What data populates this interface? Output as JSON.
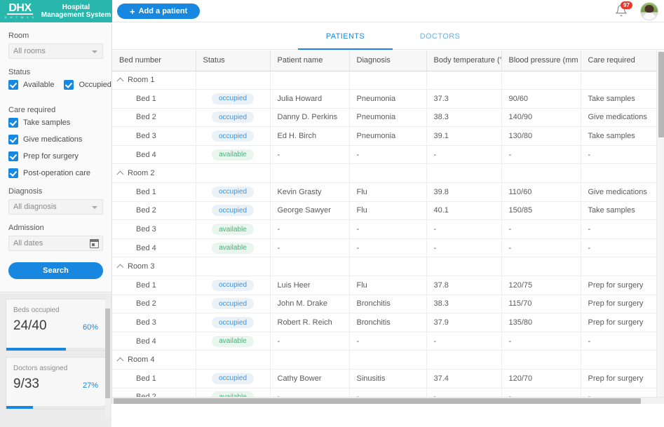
{
  "header": {
    "logo_mark": "DHX",
    "logo_sub": "D H T M L X",
    "app_title": "Hospital Management System",
    "add_patient_label": "Add a patient",
    "plus_icon": "+",
    "notification_count": "97"
  },
  "sidebar": {
    "room_label": "Room",
    "room_value": "All rooms",
    "status_label": "Status",
    "status_options": [
      {
        "label": "Available",
        "checked": true
      },
      {
        "label": "Occupied",
        "checked": true
      }
    ],
    "care_label": "Care required",
    "care_options": [
      {
        "label": "Take samples",
        "checked": true
      },
      {
        "label": "Give medications",
        "checked": true
      },
      {
        "label": "Prep for surgery",
        "checked": true
      },
      {
        "label": "Post-operation care",
        "checked": true
      }
    ],
    "diagnosis_label": "Diagnosis",
    "diagnosis_value": "All diagnosis",
    "admission_label": "Admission",
    "admission_value": "All dates",
    "search_label": "Search"
  },
  "stats": [
    {
      "title": "Beds occupied",
      "value": "24/40",
      "percent": "60%",
      "fill": 60
    },
    {
      "title": "Doctors assigned",
      "value": "9/33",
      "percent": "27%",
      "fill": 27
    }
  ],
  "tabs": [
    {
      "label": "PATIENTS",
      "active": true
    },
    {
      "label": "DOCTORS",
      "active": false
    }
  ],
  "table": {
    "columns": [
      "Bed number",
      "Status",
      "Patient name",
      "Diagnosis",
      "Body temperature (°C)",
      "Blood pressure (mm HG)",
      "Care required"
    ],
    "rows": [
      {
        "type": "group",
        "label": "Room 1"
      },
      {
        "type": "bed",
        "bed": "Bed 1",
        "status": "occupied",
        "name": "Julia Howard",
        "diagnosis": "Pneumonia",
        "temp": "37.3",
        "pressure": "90/60",
        "care": "Take samples"
      },
      {
        "type": "bed",
        "bed": "Bed 2",
        "status": "occupied",
        "name": "Danny D. Perkins",
        "diagnosis": "Pneumonia",
        "temp": "38.3",
        "pressure": "140/90",
        "care": "Give medications"
      },
      {
        "type": "bed",
        "bed": "Bed 3",
        "status": "occupied",
        "name": "Ed H. Birch",
        "diagnosis": "Pneumonia",
        "temp": "39.1",
        "pressure": "130/80",
        "care": "Take samples"
      },
      {
        "type": "bed",
        "bed": "Bed 4",
        "status": "available",
        "name": "-",
        "diagnosis": "-",
        "temp": "-",
        "pressure": "-",
        "care": "-"
      },
      {
        "type": "group",
        "label": "Room 2"
      },
      {
        "type": "bed",
        "bed": "Bed 1",
        "status": "occupied",
        "name": "Kevin Grasty",
        "diagnosis": "Flu",
        "temp": "39.8",
        "pressure": "110/60",
        "care": "Give medications"
      },
      {
        "type": "bed",
        "bed": "Bed 2",
        "status": "occupied",
        "name": "George Sawyer",
        "diagnosis": "Flu",
        "temp": "40.1",
        "pressure": "150/85",
        "care": "Take samples"
      },
      {
        "type": "bed",
        "bed": "Bed 3",
        "status": "available",
        "name": "-",
        "diagnosis": "-",
        "temp": "-",
        "pressure": "-",
        "care": "-"
      },
      {
        "type": "bed",
        "bed": "Bed 4",
        "status": "available",
        "name": "-",
        "diagnosis": "-",
        "temp": "-",
        "pressure": "-",
        "care": "-"
      },
      {
        "type": "group",
        "label": "Room 3"
      },
      {
        "type": "bed",
        "bed": "Bed 1",
        "status": "occupied",
        "name": "Luis Heer",
        "diagnosis": "Flu",
        "temp": "37.8",
        "pressure": "120/75",
        "care": "Prep for surgery"
      },
      {
        "type": "bed",
        "bed": "Bed 2",
        "status": "occupied",
        "name": "John M. Drake",
        "diagnosis": "Bronchitis",
        "temp": "38.3",
        "pressure": "115/70",
        "care": "Prep for surgery"
      },
      {
        "type": "bed",
        "bed": "Bed 3",
        "status": "occupied",
        "name": "Robert R. Reich",
        "diagnosis": "Bronchitis",
        "temp": "37.9",
        "pressure": "135/80",
        "care": "Prep for surgery"
      },
      {
        "type": "bed",
        "bed": "Bed 4",
        "status": "available",
        "name": "-",
        "diagnosis": "-",
        "temp": "-",
        "pressure": "-",
        "care": "-"
      },
      {
        "type": "group",
        "label": "Room 4"
      },
      {
        "type": "bed",
        "bed": "Bed 1",
        "status": "occupied",
        "name": "Cathy Bower",
        "diagnosis": "Sinusitis",
        "temp": "37.4",
        "pressure": "120/70",
        "care": "Prep for surgery"
      },
      {
        "type": "bed",
        "bed": "Bed 2",
        "status": "available",
        "name": "-",
        "diagnosis": "-",
        "temp": "-",
        "pressure": "-",
        "care": "-"
      }
    ]
  }
}
